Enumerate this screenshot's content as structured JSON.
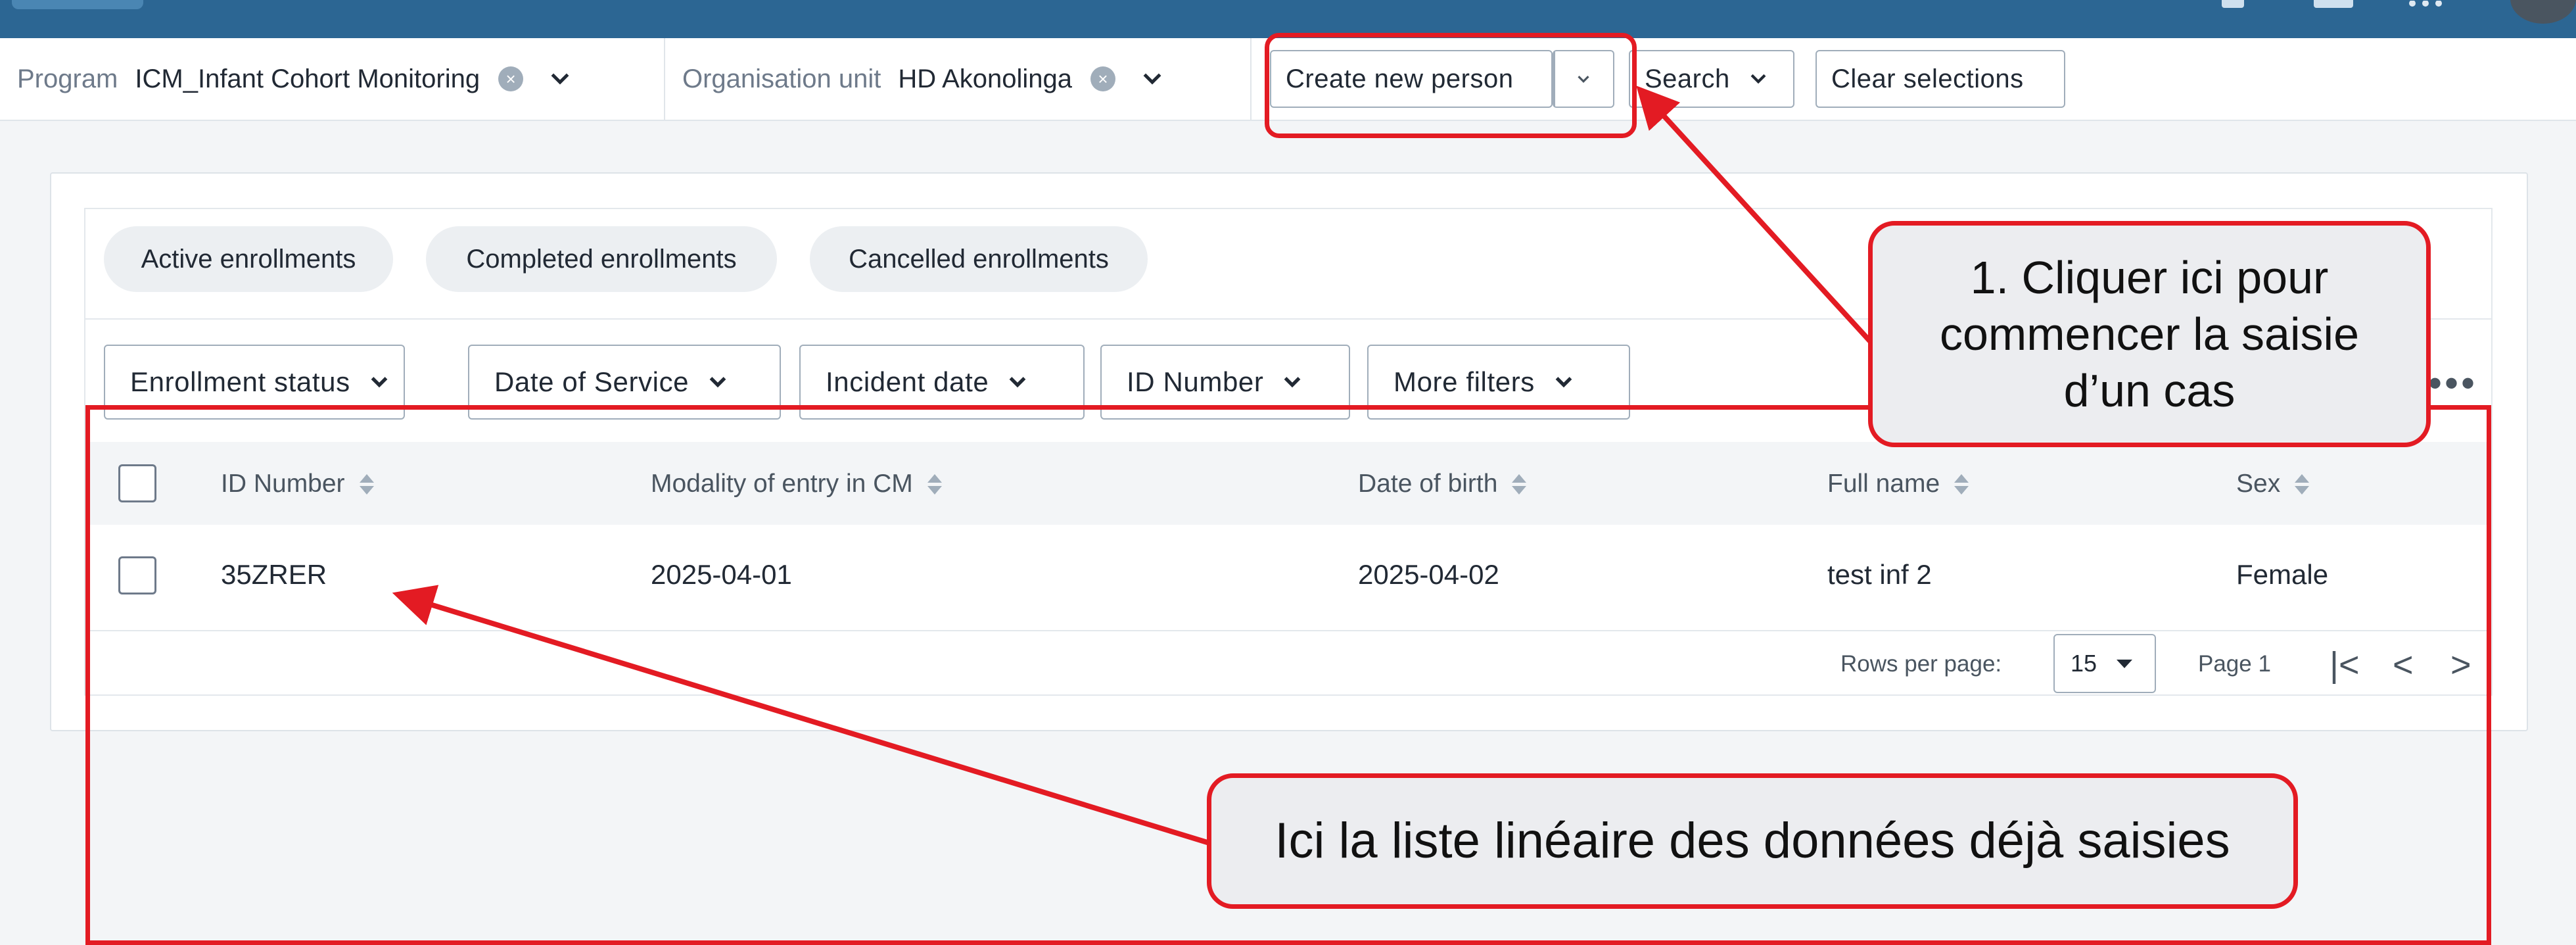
{
  "header": {
    "logo": "dhis2-logo",
    "icons": [
      "megaphone-icon",
      "chat-icon",
      "apps-icon",
      "profile-avatar"
    ]
  },
  "context": {
    "program_label": "Program",
    "program_value": "ICM_Infant Cohort Monitoring",
    "orgunit_label": "Organisation unit",
    "orgunit_value": "HD Akonolinga",
    "create_button": "Create new person",
    "search_button": "Search",
    "clear_button": "Clear selections"
  },
  "status_chips": [
    "Active enrollments",
    "Completed enrollments",
    "Cancelled enrollments"
  ],
  "filters": [
    "Enrollment status",
    "Date of Service",
    "Incident date",
    "ID Number",
    "More filters"
  ],
  "more_menu": "•••",
  "table": {
    "columns": [
      "ID Number",
      "Modality of entry in CM",
      "Date of birth",
      "Full name",
      "Sex"
    ],
    "rows": [
      [
        "35ZRER",
        "2025-04-01",
        "2025-04-02",
        "test inf 2",
        "Female"
      ]
    ]
  },
  "pagination": {
    "rows_per_page_label": "Rows per page:",
    "rows_per_page_value": "15",
    "page_label": "Page 1",
    "first_glyph": "|<",
    "prev_glyph": "<",
    "next_glyph": ">"
  },
  "annotations": {
    "callout_create": "1. Cliquer ici pour commencer la saisie d’un cas",
    "callout_list": "Ici la liste linéaire des données déjà saisies",
    "color": "#e31b23"
  },
  "colors": {
    "header": "#2c6693",
    "accent_red": "#e31b23",
    "chip_bg": "#eceff2"
  }
}
